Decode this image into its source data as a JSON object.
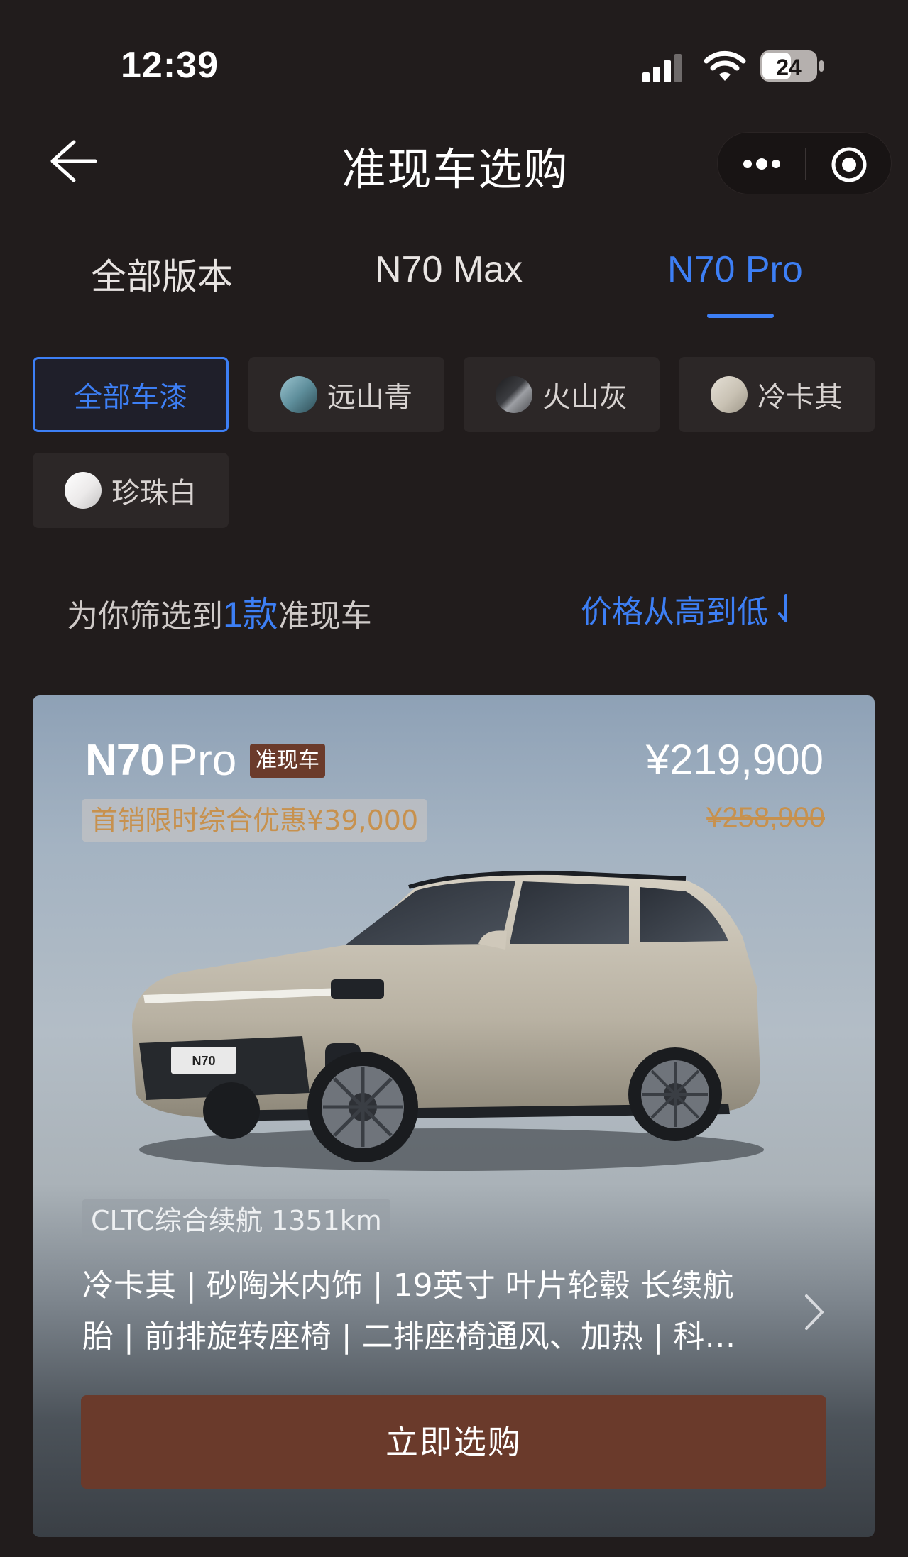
{
  "status_bar": {
    "time": "12:39",
    "battery_level": "24",
    "icons": [
      "signal-icon",
      "wifi-icon",
      "battery-icon"
    ]
  },
  "nav": {
    "title": "准现车选购",
    "back_icon": "back-arrow-icon",
    "capsule_icons": [
      "more-icon",
      "target-icon"
    ]
  },
  "tabs": [
    {
      "label": "全部版本",
      "active": false
    },
    {
      "label": "N70 Max",
      "active": false
    },
    {
      "label": "N70 Pro",
      "active": true
    }
  ],
  "colors": {
    "accent": "#3d7ff5",
    "background": "#211c1c",
    "chip_background": "#2c2727",
    "badge": "#6b3b2b",
    "button": "#6a3a2b",
    "discount_text": "#c7914e"
  },
  "paint_filters": [
    {
      "label": "全部车漆",
      "active": true
    },
    {
      "label": "远山青",
      "swatch": "teal"
    },
    {
      "label": "火山灰",
      "swatch": "grey"
    },
    {
      "label": "冷卡其",
      "swatch": "khaki"
    },
    {
      "label": "珍珠白",
      "swatch": "white"
    }
  ],
  "filter": {
    "prefix": "为你筛选到",
    "count": "1款",
    "suffix": "准现车",
    "sort_label": "价格从高到低"
  },
  "card": {
    "model_main": "N70",
    "model_sub": "Pro",
    "badge": "准现车",
    "price": "¥219,900",
    "original_price": "¥258,900",
    "discount": "首销限时综合优惠¥39,000",
    "car_plate": "N70",
    "range": "CLTC综合续航 1351km",
    "spec_line1": "冷卡其 | 砂陶米内饰 | 19英寸 叶片轮毂 长续航",
    "spec_line2": "胎 | 前排旋转座椅 | 二排座椅通风、加热 | 科…",
    "buy_label": "立即选购"
  }
}
